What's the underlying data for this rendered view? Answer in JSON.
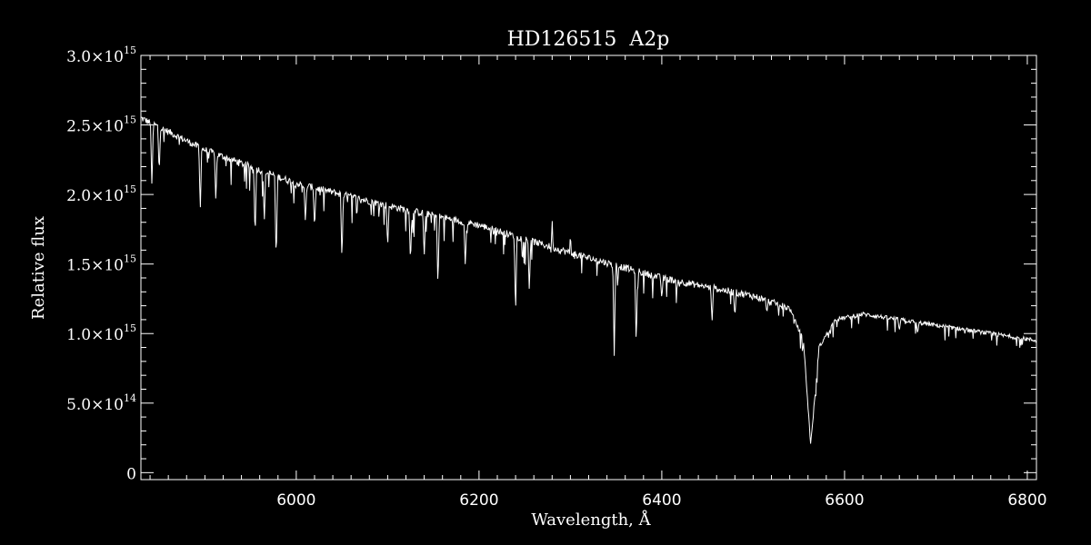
{
  "chart_data": {
    "type": "line",
    "title": "HD126515  A2p",
    "xlabel": "Wavelength, Å",
    "ylabel": "Relative flux",
    "xlim": [
      5830,
      6810
    ],
    "ylim": [
      -50000000000000.0,
      3000000000000000.0
    ],
    "grid": false,
    "legend": "none",
    "x_ticks": [
      6000,
      6200,
      6400,
      6600,
      6800
    ],
    "x_tick_labels": [
      "6000",
      "6200",
      "6400",
      "6600",
      "6800"
    ],
    "y_ticks": [
      0,
      500000000000000.0,
      1000000000000000.0,
      1500000000000000.0,
      2000000000000000.0,
      2500000000000000.0,
      3000000000000000.0
    ],
    "y_tick_labels": [
      {
        "mant": "0",
        "exp": ""
      },
      {
        "mant": "5.0×10",
        "exp": "14"
      },
      {
        "mant": "1.0×10",
        "exp": "15"
      },
      {
        "mant": "1.5×10",
        "exp": "15"
      },
      {
        "mant": "2.0×10",
        "exp": "15"
      },
      {
        "mant": "2.5×10",
        "exp": "15"
      },
      {
        "mant": "3.0×10",
        "exp": "15"
      }
    ],
    "series": [
      {
        "color": "#ffffff",
        "continuum": [
          [
            5830,
            2550000000000000.0
          ],
          [
            5900,
            2320000000000000.0
          ],
          [
            6000,
            2080000000000000.0
          ],
          [
            6100,
            1920000000000000.0
          ],
          [
            6200,
            1780000000000000.0
          ],
          [
            6300,
            1580000000000000.0
          ],
          [
            6400,
            1400000000000000.0
          ],
          [
            6500,
            1270000000000000.0
          ],
          [
            6540,
            1180000000000000.0
          ],
          [
            6555,
            950000000000000.0
          ],
          [
            6563,
            200000000000000.0
          ],
          [
            6572,
            900000000000000.0
          ],
          [
            6590,
            1100000000000000.0
          ],
          [
            6620,
            1140000000000000.0
          ],
          [
            6700,
            1060000000000000.0
          ],
          [
            6810,
            950000000000000.0
          ]
        ],
        "absorption_lines": [
          [
            5842,
            2050000000000000.0
          ],
          [
            5850,
            2150000000000000.0
          ],
          [
            5895,
            1880000000000000.0
          ],
          [
            5912,
            1950000000000000.0
          ],
          [
            5955,
            1680000000000000.0
          ],
          [
            5965,
            1800000000000000.0
          ],
          [
            5978,
            1500000000000000.0
          ],
          [
            6010,
            1800000000000000.0
          ],
          [
            6020,
            1750000000000000.0
          ],
          [
            6050,
            1520000000000000.0
          ],
          [
            6100,
            1620000000000000.0
          ],
          [
            6125,
            1500000000000000.0
          ],
          [
            6140,
            1550000000000000.0
          ],
          [
            6155,
            1330000000000000.0
          ],
          [
            6185,
            1480000000000000.0
          ],
          [
            6240,
            1130000000000000.0
          ],
          [
            6255,
            1300000000000000.0
          ],
          [
            6280,
            1420000000000000.0
          ],
          [
            6348,
            840000000000000.0
          ],
          [
            6372,
            910000000000000.0
          ],
          [
            6400,
            1250000000000000.0
          ],
          [
            6455,
            1080000000000000.0
          ],
          [
            6480,
            1120000000000000.0
          ],
          [
            6515,
            1150000000000000.0
          ],
          [
            6660,
            1020000000000000.0
          ],
          [
            6680,
            1000000000000000.0
          ]
        ],
        "emission_spikes": [
          [
            6280,
            1830000000000000.0
          ],
          [
            6300,
            1720000000000000.0
          ]
        ]
      }
    ]
  }
}
